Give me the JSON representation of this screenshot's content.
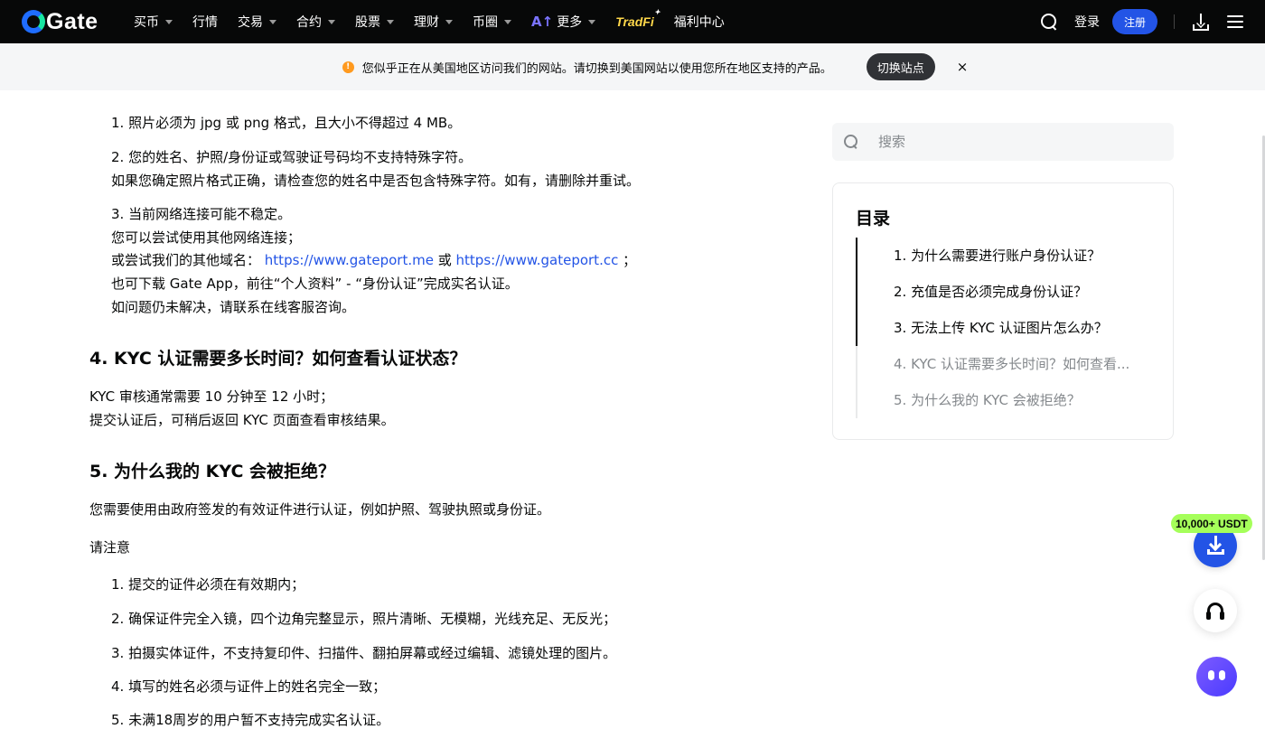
{
  "brand": {
    "name": "Gate",
    "accent": "#2354e6",
    "secondary": "#17e6a1"
  },
  "nav": {
    "items": [
      {
        "label": "买币",
        "caret": true
      },
      {
        "label": "行情",
        "caret": false
      },
      {
        "label": "交易",
        "caret": true
      },
      {
        "label": "合约",
        "caret": true
      },
      {
        "label": "股票",
        "caret": true
      },
      {
        "label": "理财",
        "caret": true
      },
      {
        "label": "币圈",
        "caret": true
      }
    ],
    "more_label": "更多",
    "tradfi_label": "TradFi",
    "rewards_label": "福利中心",
    "login_label": "登录",
    "signup_label": "注册",
    "icons": [
      "search-icon",
      "download-icon",
      "menu-icon"
    ]
  },
  "notice": {
    "text": "您似乎正在从美国地区访问我们的网站。请切换到美国网站以使用您所在地区支持的产品。",
    "button_label": "切换站点",
    "close_label": "×",
    "icon": "warning-icon",
    "icon_color": "#ff9a1f"
  },
  "article": {
    "upload_tips": {
      "item1": "1. 照片必须为 jpg 或 png 格式，且大小不得超过 4 MB。",
      "item2": "2. 您的姓名、护照/身份证或驾驶证号码均不支持特殊字符。",
      "item2_note": "如果您确定照片格式正确，请检查您的姓名中是否包含特殊字符。如有，请删除并重试。",
      "item3": "3. 当前网络连接可能不稳定。",
      "item3_note1": "您可以尝试使用其他网络连接；",
      "item3_note2_prefix": "或尝试我们的其他域名：",
      "link1": "https://www.gateport.me",
      "or_word": "或",
      "link2": "https://www.gateport.cc",
      "item3_note2_suffix": "；",
      "item3_note3": "也可下载 Gate App，前往“个人资料” - “身份认证”完成实名认证。",
      "item3_note4": "如问题仍未解决，请联系在线客服咨询。"
    },
    "section4": {
      "heading": "4. KYC 认证需要多长时间？如何查看认证状态？",
      "p1": "KYC 审核通常需要 10 分钟至 12 小时；",
      "p2": "提交认证后，可稍后返回 KYC 页面查看审核结果。"
    },
    "section5": {
      "heading": "5. 为什么我的 KYC 会被拒绝？",
      "intro": "您需要使用由政府签发的有效证件进行认证，例如护照、驾驶执照或身份证。",
      "note_label": "请注意",
      "items": [
        "1. 提交的证件必须在有效期内；",
        "2. 确保证件完全入镜，四个边角完整显示，照片清晰、无模糊，光线充足、无反光；",
        "3. 拍摄实体证件，不支持复印件、扫描件、翻拍屏幕或经过编辑、滤镜处理的图片。",
        "4. 填写的姓名必须与证件上的姓名完全一致；",
        "5. 未满18周岁的用户暂不支持完成实名认证。"
      ]
    }
  },
  "sidebar": {
    "search_placeholder": "搜索",
    "toc_title": "目录",
    "toc_items": [
      "1. 为什么需要进行账户身份认证？",
      "2. 充值是否必须完成身份认证？",
      "3. 无法上传 KYC 认证图片怎么办？",
      "4. KYC 认证需要多长时间？如何查看...",
      "5. 为什么我的 KYC 会被拒绝？"
    ]
  },
  "floating": {
    "badge": "10,000+ USDT",
    "badge_color": "#a5ff5a",
    "icons": [
      "download-app-icon",
      "headset-icon",
      "chatbot-icon"
    ]
  }
}
